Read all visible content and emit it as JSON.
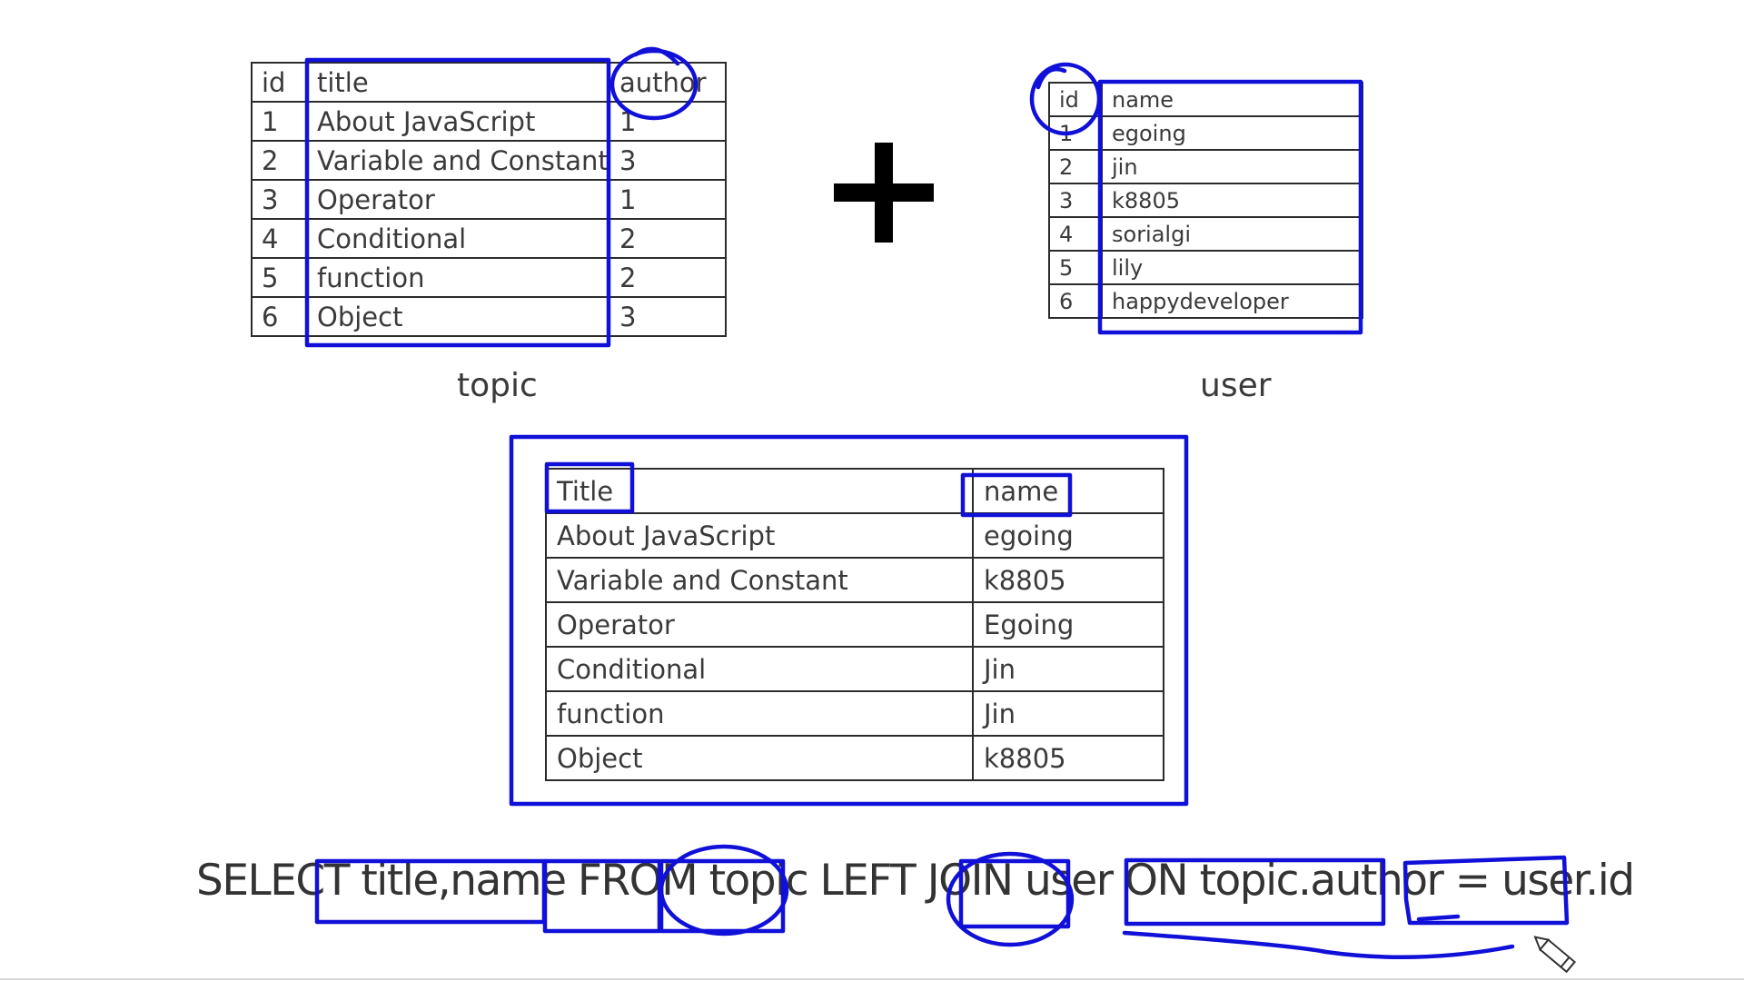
{
  "topic_table": {
    "header": {
      "id": "id",
      "title": "title",
      "author": "author"
    },
    "rows": [
      {
        "id": "1",
        "title": "About JavaScript",
        "author": "1"
      },
      {
        "id": "2",
        "title": "Variable and Constant",
        "author": "3"
      },
      {
        "id": "3",
        "title": "Operator",
        "author": "1"
      },
      {
        "id": "4",
        "title": "Conditional",
        "author": "2"
      },
      {
        "id": "5",
        "title": "function",
        "author": "2"
      },
      {
        "id": "6",
        "title": "Object",
        "author": "3"
      }
    ],
    "caption": "topic"
  },
  "user_table": {
    "header": {
      "id": "id",
      "name": "name"
    },
    "rows": [
      {
        "id": "1",
        "name": "egoing"
      },
      {
        "id": "2",
        "name": "jin"
      },
      {
        "id": "3",
        "name": "k8805"
      },
      {
        "id": "4",
        "name": "sorialgi"
      },
      {
        "id": "5",
        "name": "lily"
      },
      {
        "id": "6",
        "name": "happydeveloper"
      }
    ],
    "caption": "user"
  },
  "result_table": {
    "header": {
      "title": "Title",
      "name": "name"
    },
    "rows": [
      {
        "title": "About JavaScript",
        "name": "egoing"
      },
      {
        "title": "Variable and Constant",
        "name": "k8805"
      },
      {
        "title": "Operator",
        "name": "Egoing"
      },
      {
        "title": "Conditional",
        "name": "Jin"
      },
      {
        "title": "function",
        "name": "Jin"
      },
      {
        "title": "Object",
        "name": "k8805"
      }
    ]
  },
  "sql": "SELECT title,name FROM topic LEFT JOIN user ON topic.author = user.id",
  "annotation_color": "#1010d8",
  "tool_icon": "pencil-cursor-icon"
}
